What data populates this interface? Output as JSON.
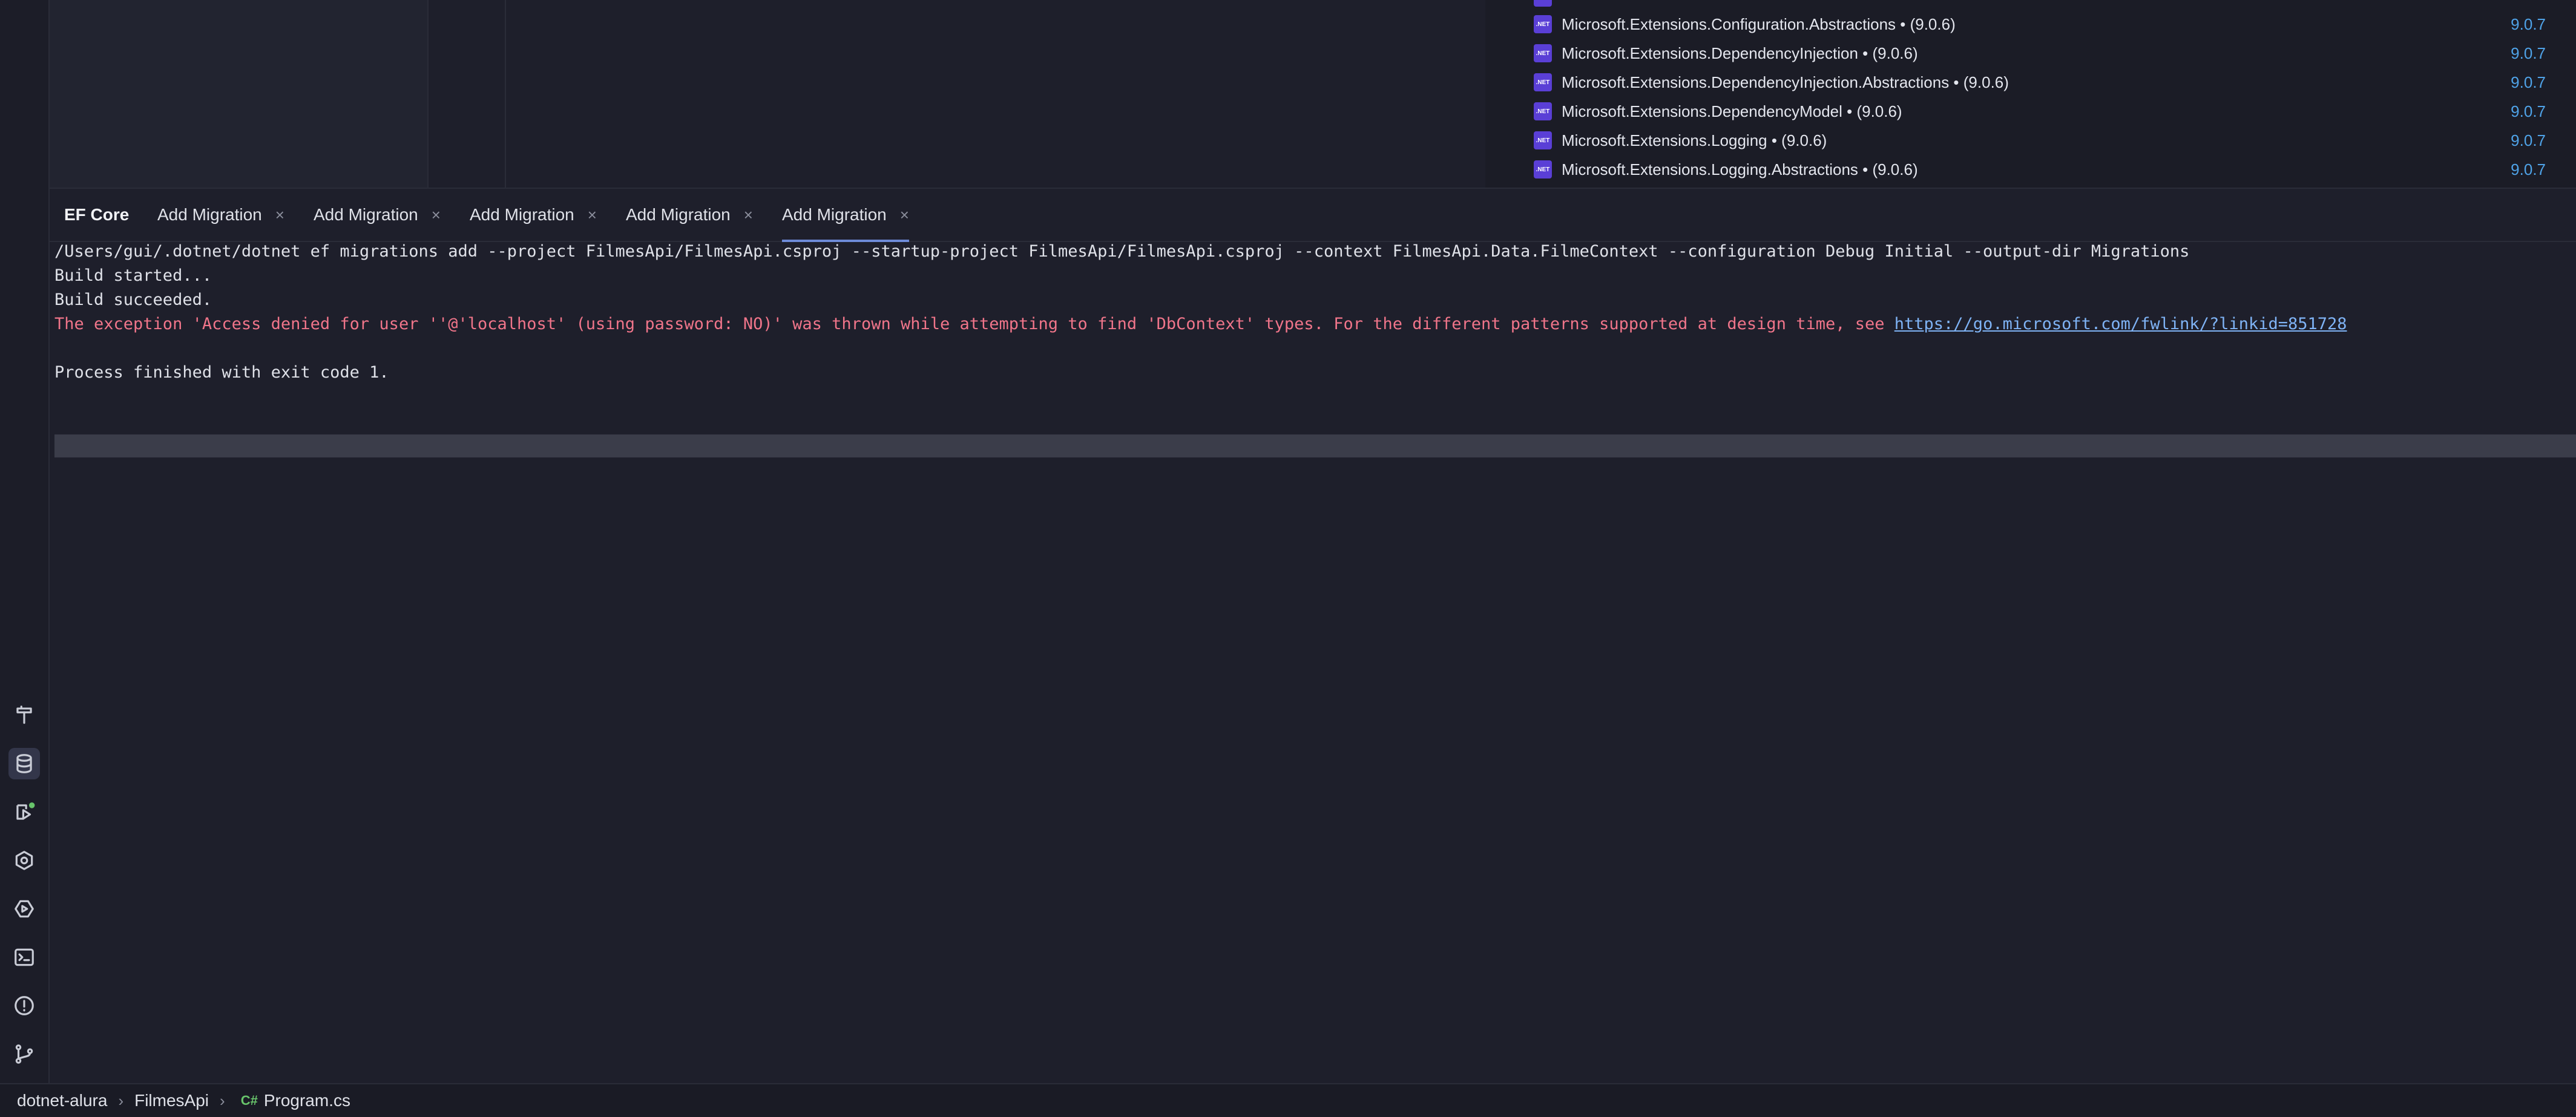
{
  "packages": [
    {
      "name": "Microsoft.Extensions.Configuration.Abstractions • (9.0.6)",
      "version": "9.0.7"
    },
    {
      "name": "Microsoft.Extensions.DependencyInjection • (9.0.6)",
      "version": "9.0.7"
    },
    {
      "name": "Microsoft.Extensions.DependencyInjection.Abstractions • (9.0.6)",
      "version": "9.0.7"
    },
    {
      "name": "Microsoft.Extensions.DependencyModel • (9.0.6)",
      "version": "9.0.7"
    },
    {
      "name": "Microsoft.Extensions.Logging • (9.0.6)",
      "version": "9.0.7"
    },
    {
      "name": "Microsoft.Extensions.Logging.Abstractions • (9.0.6)",
      "version": "9.0.7"
    }
  ],
  "package_icon_label": ".NET",
  "tabs": {
    "ef_core": "EF Core",
    "items": [
      "Add Migration",
      "Add Migration",
      "Add Migration",
      "Add Migration",
      "Add Migration"
    ],
    "close_glyph": "×"
  },
  "console": {
    "command": "/Users/gui/.dotnet/dotnet ef migrations add --project FilmesApi/FilmesApi.csproj --startup-project FilmesApi/FilmesApi.csproj --context FilmesApi.Data.FilmeContext --configuration Debug Initial --output-dir Migrations",
    "build_started": "Build started...",
    "build_succeeded": "Build succeeded.",
    "error_text": "The exception 'Access denied for user ''@'localhost' (using password: NO)' was thrown while attempting to find 'DbContext' types. For the different patterns supported at design time, see ",
    "error_link": "https://go.microsoft.com/fwlink/?linkid=851728",
    "exit": "Process finished with exit code 1."
  },
  "toolstrip": [
    "hammer-icon",
    "database-icon",
    "run-icon",
    "services-icon",
    "play-circle-icon",
    "terminal-icon",
    "problems-icon",
    "git-icon"
  ],
  "statusbar": {
    "project": "dotnet-alura",
    "folder": "FilmesApi",
    "lang_badge": "C#",
    "file": "Program.cs",
    "sep": "›"
  },
  "colors": {
    "accent": "#6e8bd8",
    "error": "#f0758a",
    "link": "#7fb3f5",
    "version": "#4fa3e8",
    "package_icon": "#5a3fd6",
    "run_dot": "#68c46b"
  }
}
